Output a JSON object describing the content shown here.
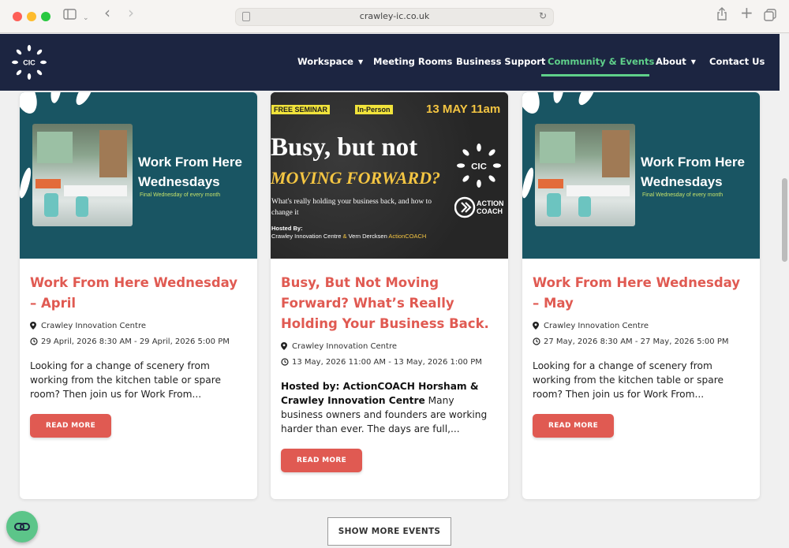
{
  "browser": {
    "url": "crawley-ic.co.uk"
  },
  "nav": {
    "logo_text": "CIC",
    "items": [
      {
        "label": "Workspace",
        "dropdown": true
      },
      {
        "label": "Meeting Rooms",
        "dropdown": false
      },
      {
        "label": "Business Support",
        "dropdown": false
      },
      {
        "label": "Community & Events",
        "dropdown": false,
        "active": true
      },
      {
        "label": "About",
        "dropdown": true
      },
      {
        "label": "Contact Us",
        "dropdown": false
      }
    ]
  },
  "colors": {
    "nav_bg": "#1c2541",
    "accent_green": "#5fd08a",
    "title_red": "#e05a52",
    "teal": "#195563"
  },
  "cards": [
    {
      "image": {
        "title_line1": "Work From Here",
        "title_line2": "Wednesdays",
        "subtitle": "Final Wednesday of every month"
      },
      "title": "Work From Here Wednesday – April",
      "location": "Crawley Innovation Centre",
      "datetime": "29 April, 2026 8:30 AM - 29 April, 2026 5:00 PM",
      "excerpt": "Looking for a change of scenery from working from the kitchen table or spare room? Then join us for Work From...",
      "button": "READ MORE"
    },
    {
      "image": {
        "tag1": "FREE SEMINAR",
        "tag2": "In-Person",
        "date": "13 MAY 11am",
        "headline1": "Busy, but not",
        "headline2": "MOVING FORWARD?",
        "desc": "What's really holding your business back, and how to change it",
        "hosted_label": "Hosted By:",
        "hosted_a": "Crawley Innovation Centre",
        "hosted_amp": " & ",
        "hosted_b": "Vern Dercksen ",
        "hosted_c": "ActionCOACH",
        "logo_text": "CIC",
        "action_line1": "ACTION",
        "action_line2": "COACH"
      },
      "title": "Busy, But Not Moving Forward? What’s Really Holding Your Business Back.",
      "location": "Crawley Innovation Centre",
      "datetime": "13 May, 2026 11:00 AM - 13 May, 2026 1:00 PM",
      "excerpt_bold": "Hosted by: ActionCOACH Horsham & Crawley Innovation Centre",
      "excerpt": " Many business owners and founders are working harder than ever. The days are full,...",
      "button": "READ MORE"
    },
    {
      "image": {
        "title_line1": "Work From Here",
        "title_line2": "Wednesdays",
        "subtitle": "Final Wednesday of every month"
      },
      "title": "Work From Here Wednesday – May",
      "location": "Crawley Innovation Centre",
      "datetime": "27 May, 2026 8:30 AM - 27 May, 2026 5:00 PM",
      "excerpt": "Looking for a change of scenery from working from the kitchen table or spare room? Then join us for Work From...",
      "button": "READ MORE"
    }
  ],
  "show_more": "SHOW MORE EVENTS"
}
